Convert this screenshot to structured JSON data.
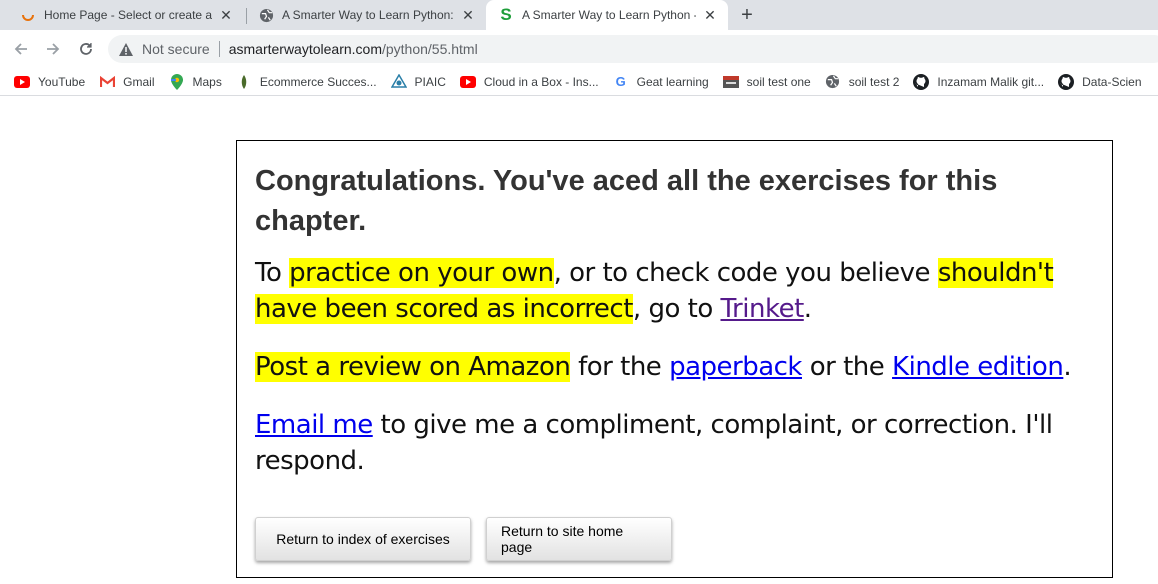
{
  "browser": {
    "tabs": [
      {
        "title": "Home Page - Select or create a n",
        "icon": "loading-spinner-icon"
      },
      {
        "title": "A Smarter Way to Learn Python: I",
        "icon": "globe-icon"
      },
      {
        "title": "A Smarter Way to Learn Python -",
        "icon": "s-logo-icon"
      }
    ],
    "active_tab": 2,
    "new_tab_label": "+",
    "address": {
      "security_label": "Not secure",
      "host": "asmarterwaytolearn.com",
      "path": "/python/55.html"
    },
    "bookmarks": [
      {
        "label": "YouTube",
        "icon": "youtube-icon"
      },
      {
        "label": "Gmail",
        "icon": "gmail-icon"
      },
      {
        "label": "Maps",
        "icon": "maps-icon"
      },
      {
        "label": "Ecommerce Succes...",
        "icon": "ecommerce-icon"
      },
      {
        "label": "PIAIC",
        "icon": "piaic-icon"
      },
      {
        "label": "Cloud in a Box - Ins...",
        "icon": "youtube-icon"
      },
      {
        "label": "Geat learning",
        "icon": "google-icon"
      },
      {
        "label": "soil test one",
        "icon": "sts-icon"
      },
      {
        "label": "soil test 2",
        "icon": "globe-icon"
      },
      {
        "label": "Inzamam Malik git...",
        "icon": "github-icon"
      },
      {
        "label": "Data-Scien",
        "icon": "github-icon"
      }
    ]
  },
  "page": {
    "heading": "Congratulations. You've aced all the exercises for this chapter.",
    "para1": {
      "t1": "To ",
      "hl1": "practice on your own",
      "t2": ", or to check code you believe ",
      "hl2": "shouldn't have been scored as incorrect",
      "t3": ", go to ",
      "link": "Trinket",
      "t4": "."
    },
    "para2": {
      "hl1": "Post a review on Amazon",
      "t1": " for the ",
      "link1": "paperback",
      "t2": " or the ",
      "link2": "Kindle edition",
      "t3": "."
    },
    "para3": {
      "link": "Email me",
      "t1": " to give me a compliment, complaint, or correction. I'll respond."
    },
    "buttons": {
      "index": "Return to index of exercises",
      "home": "Return to site home page"
    }
  },
  "colors": {
    "highlight": "#ffff00",
    "link": "#0000ee",
    "visited_link": "#551a8b"
  }
}
